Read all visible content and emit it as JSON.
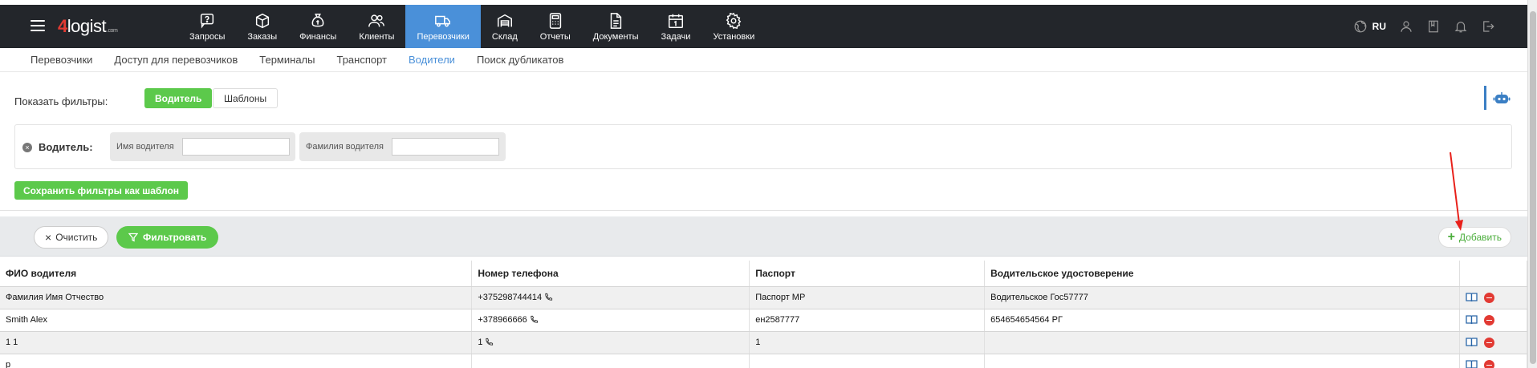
{
  "app": {
    "logo_prefix": "4",
    "logo_text": "logist",
    "logo_suffix": ".com"
  },
  "nav": [
    {
      "label": "Запросы",
      "icon": "question-chat-icon"
    },
    {
      "label": "Заказы",
      "icon": "box-icon"
    },
    {
      "label": "Финансы",
      "icon": "money-bag-icon"
    },
    {
      "label": "Клиенты",
      "icon": "users-icon"
    },
    {
      "label": "Перевозчики",
      "icon": "truck-icon",
      "active": true
    },
    {
      "label": "Склад",
      "icon": "warehouse-icon"
    },
    {
      "label": "Отчеты",
      "icon": "calculator-icon"
    },
    {
      "label": "Документы",
      "icon": "document-icon"
    },
    {
      "label": "Задачи",
      "icon": "calendar-icon"
    },
    {
      "label": "Установки",
      "icon": "gear-icon"
    }
  ],
  "top_right": {
    "language": "RU"
  },
  "subnav": [
    {
      "label": "Перевозчики"
    },
    {
      "label": "Доступ для перевозчиков"
    },
    {
      "label": "Терминалы"
    },
    {
      "label": "Транспорт"
    },
    {
      "label": "Водители",
      "active": true
    },
    {
      "label": "Поиск дубликатов"
    }
  ],
  "filters": {
    "show_label": "Показать фильтры:",
    "tab_driver": "Водитель",
    "tab_templates": "Шаблоны",
    "group_label": "Водитель:",
    "first_name_label": "Имя водителя",
    "first_name_value": "",
    "last_name_label": "Фамилия водителя",
    "last_name_value": "",
    "save_template": "Сохранить фильтры как шаблон"
  },
  "actions": {
    "clear": "Очистить",
    "filter": "Фильтровать",
    "add": "Добавить"
  },
  "table": {
    "headers": [
      "ФИО водителя",
      "Номер телефона",
      "Паспорт",
      "Водительское удостоверение",
      ""
    ],
    "rows": [
      {
        "name": "Фамилия Имя Отчество",
        "phone": "+375298744414",
        "passport": "Паспорт МР",
        "license": "Водительское Гос57777"
      },
      {
        "name": "Smith Alex",
        "phone": "+378966666",
        "passport": "ен2587777",
        "license": "654654654564 РГ"
      },
      {
        "name": "1 1",
        "phone": "1",
        "passport": "1",
        "license": ""
      },
      {
        "name": "р",
        "phone": "",
        "passport": "",
        "license": ""
      }
    ]
  },
  "colors": {
    "topbar": "#23262b",
    "active_nav": "#4a90d9",
    "green": "#5cc94b",
    "danger": "#e23a33"
  }
}
